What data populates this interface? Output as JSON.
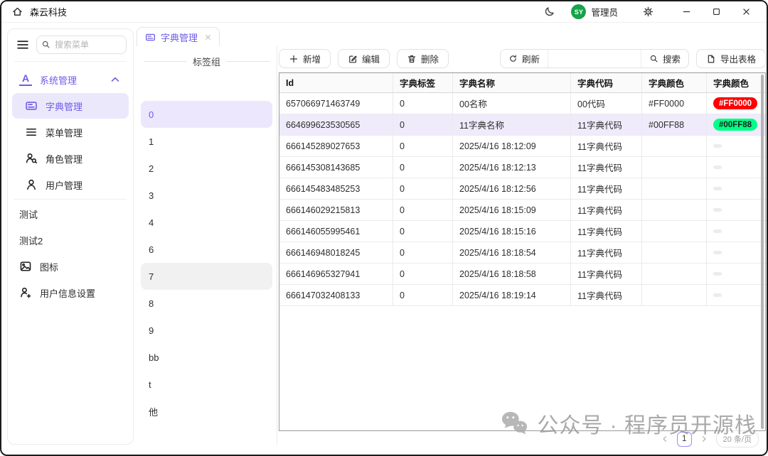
{
  "colors": {
    "accent": "#6c5ce7",
    "selected_row_bg": "#efebfb",
    "selected_item_bg": "#ece8fc",
    "badge_red": "#FF0000",
    "badge_green": "#00FF88",
    "avatar_green": "#16a34a"
  },
  "titlebar": {
    "app_title": "森云科技",
    "user": {
      "avatar_text": "SY",
      "name": "管理员",
      "avatar_color": "#16a34a"
    }
  },
  "tabs": [
    {
      "id": "dict",
      "label": "字典管理",
      "icon": "dict-icon",
      "active": true,
      "closable": true
    }
  ],
  "sidebar": {
    "search": {
      "placeholder": "搜索菜单",
      "value": ""
    },
    "items": [
      {
        "id": "system-management",
        "label": "系统管理",
        "icon": "letter-a-icon",
        "level": 0,
        "accent": true,
        "expanded": true
      },
      {
        "id": "dict-management",
        "label": "字典管理",
        "icon": "dict-icon",
        "level": 1,
        "selected": true
      },
      {
        "id": "menu-management",
        "label": "菜单管理",
        "icon": "menu-icon",
        "level": 1
      },
      {
        "id": "role-management",
        "label": "角色管理",
        "icon": "role-icon",
        "level": 1
      },
      {
        "id": "user-management",
        "label": "用户管理",
        "icon": "user-icon",
        "level": 1
      },
      {
        "id": "test",
        "label": "测试",
        "icon": null,
        "level": 0,
        "divider_before": true
      },
      {
        "id": "test2",
        "label": "测试2",
        "icon": null,
        "level": 0
      },
      {
        "id": "icons",
        "label": "图标",
        "icon": "image-icon",
        "level": 0
      },
      {
        "id": "user-info-settings",
        "label": "用户信息设置",
        "icon": "user-plus-icon",
        "level": 0
      }
    ]
  },
  "tag_panel": {
    "title": "标签组",
    "items": [
      {
        "label": "0",
        "state": "selected"
      },
      {
        "label": "1",
        "state": ""
      },
      {
        "label": "2",
        "state": ""
      },
      {
        "label": "3",
        "state": ""
      },
      {
        "label": "4",
        "state": ""
      },
      {
        "label": "6",
        "state": ""
      },
      {
        "label": "7",
        "state": "hover"
      },
      {
        "label": "8",
        "state": ""
      },
      {
        "label": "9",
        "state": ""
      },
      {
        "label": "bb",
        "state": ""
      },
      {
        "label": "t",
        "state": ""
      },
      {
        "label": "他",
        "state": ""
      }
    ]
  },
  "toolbar": {
    "add_label": "新增",
    "edit_label": "编辑",
    "delete_label": "删除",
    "refresh_label": "刷新",
    "search_value": "",
    "search_label": "搜索",
    "export_label": "导出表格"
  },
  "table": {
    "columns": [
      "Id",
      "字典标签",
      "字典名称",
      "字典代码",
      "字典颜色",
      "字典颜色"
    ],
    "rows": [
      {
        "id": "657066971463749",
        "tag": "0",
        "name": "00名称",
        "code": "00代码",
        "color_text": "#FF0000",
        "badge": {
          "text": "#FF0000",
          "bg": "#FF0000",
          "fg": "#FFFFFF"
        },
        "selected": false
      },
      {
        "id": "664699623530565",
        "tag": "0",
        "name": "11字典名称",
        "code": "11字典代码",
        "color_text": "#00FF88",
        "badge": {
          "text": "#00FF88",
          "bg": "#00FF88",
          "fg": "#152015"
        },
        "selected": true
      },
      {
        "id": "666145289027653",
        "tag": "0",
        "name": "2025/4/16 18:12:09",
        "code": "11字典代码",
        "color_text": "",
        "badge": null,
        "selected": false
      },
      {
        "id": "666145308143685",
        "tag": "0",
        "name": "2025/4/16 18:12:13",
        "code": "11字典代码",
        "color_text": "",
        "badge": null,
        "selected": false
      },
      {
        "id": "666145483485253",
        "tag": "0",
        "name": "2025/4/16 18:12:56",
        "code": "11字典代码",
        "color_text": "",
        "badge": null,
        "selected": false
      },
      {
        "id": "666146029215813",
        "tag": "0",
        "name": "2025/4/16 18:15:09",
        "code": "11字典代码",
        "color_text": "",
        "badge": null,
        "selected": false
      },
      {
        "id": "666146055995461",
        "tag": "0",
        "name": "2025/4/16 18:15:16",
        "code": "11字典代码",
        "color_text": "",
        "badge": null,
        "selected": false
      },
      {
        "id": "666146948018245",
        "tag": "0",
        "name": "2025/4/16 18:18:54",
        "code": "11字典代码",
        "color_text": "",
        "badge": null,
        "selected": false
      },
      {
        "id": "666146965327941",
        "tag": "0",
        "name": "2025/4/16 18:18:58",
        "code": "11字典代码",
        "color_text": "",
        "badge": null,
        "selected": false
      },
      {
        "id": "666147032408133",
        "tag": "0",
        "name": "2025/4/16 18:19:14",
        "code": "11字典代码",
        "color_text": "",
        "badge": null,
        "selected": false
      }
    ]
  },
  "pagination": {
    "prev": "chevron-left-icon",
    "page": "1",
    "next": "chevron-right-icon",
    "page_size": "20 条/页"
  },
  "watermark": {
    "icon": "wechat-icon",
    "text": "公众号 · 程序员开源栈"
  }
}
